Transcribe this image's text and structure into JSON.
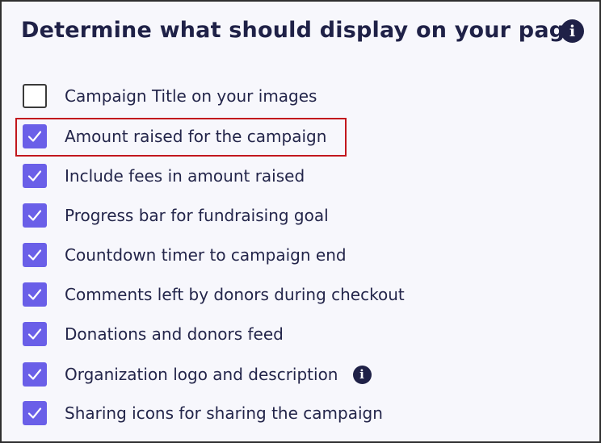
{
  "heading": "Determine what should display on your page",
  "heading_info_icon": "info-icon",
  "colors": {
    "heading": "#1f2147",
    "checkbox_checked": "#6a5fe8",
    "highlight_border": "#c2171d"
  },
  "options": [
    {
      "label": "Campaign Title on your images",
      "checked": false
    },
    {
      "label": "Amount raised for the campaign",
      "checked": true,
      "highlighted": true
    },
    {
      "label": "Include fees in amount raised",
      "checked": true
    },
    {
      "label": "Progress bar for fundraising goal",
      "checked": true
    },
    {
      "label": "Countdown timer to campaign end",
      "checked": true
    },
    {
      "label": "Comments left by donors during checkout",
      "checked": true
    },
    {
      "label": "Donations and donors feed",
      "checked": true
    },
    {
      "label": "Organization logo and description",
      "checked": true,
      "info_icon": "info-icon"
    },
    {
      "label": "Sharing icons for sharing the campaign",
      "checked": true
    }
  ]
}
